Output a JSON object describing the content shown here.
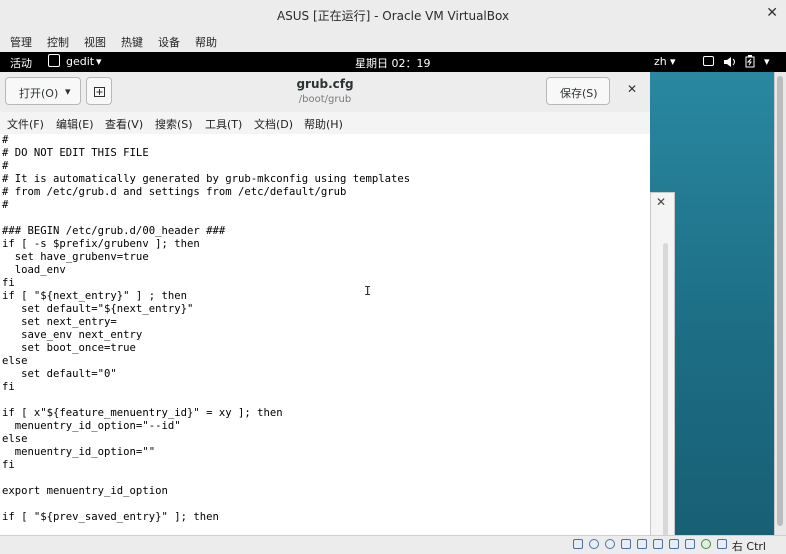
{
  "window": {
    "title": "ASUS [正在运行] - Oracle VM VirtualBox",
    "close_glyph": "✕"
  },
  "vbox_menu": [
    "管理",
    "控制",
    "视图",
    "热键",
    "设备",
    "帮助"
  ],
  "gnome_topbar": {
    "activities": "活动",
    "app_name": "gedit",
    "app_arrow": "▾",
    "clock": "星期日 02：19",
    "input_method": "zh",
    "im_arrow": "▾",
    "sys_arrow": "▾"
  },
  "gedit": {
    "open_button": "打开(O)",
    "open_arrow": "▾",
    "file_title": "grub.cfg",
    "file_path": "/boot/grub",
    "save_button": "保存(S)",
    "close_glyph": "✕",
    "menu": [
      "文件(F)",
      "编辑(E)",
      "查看(V)",
      "搜索(S)",
      "工具(T)",
      "文档(D)",
      "帮助(H)"
    ],
    "lines": [
      "#",
      "# DO NOT EDIT THIS FILE",
      "#",
      "# It is automatically generated by grub-mkconfig using templates",
      "# from /etc/grub.d and settings from /etc/default/grub",
      "#",
      "",
      "### BEGIN /etc/grub.d/00_header ###",
      "if [ -s $prefix/grubenv ]; then",
      "  set have_grubenv=true",
      "  load_env",
      "fi",
      "if [ \"${next_entry}\" ] ; then",
      "   set default=\"${next_entry}\"",
      "   set next_entry=",
      "   save_env next_entry",
      "   set boot_once=true",
      "else",
      "   set default=\"0\"",
      "fi",
      "",
      "if [ x\"${feature_menuentry_id}\" = xy ]; then",
      "  menuentry_id_option=\"--id\"",
      "else",
      "  menuentry_id_option=\"\"",
      "fi",
      "",
      "export menuentry_id_option",
      "",
      "if [ \"${prev_saved_entry}\" ]; then"
    ]
  },
  "behind_window": {
    "close_glyph": "✕"
  },
  "statusbar": {
    "host_key": "右 Ctrl"
  },
  "colors": {
    "desktop": "#1d6f86",
    "topbar": "#000000",
    "headerbar": "#ededed"
  }
}
